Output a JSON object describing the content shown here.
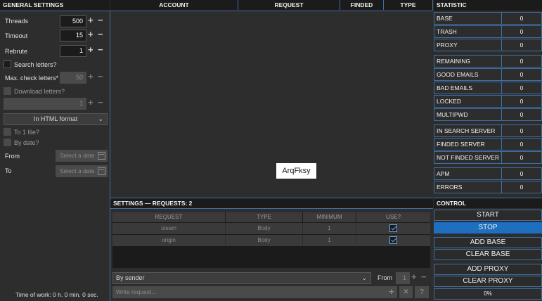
{
  "general": {
    "title": "GENERAL SETTINGS",
    "threads": {
      "label": "Threads",
      "value": "500"
    },
    "timeout": {
      "label": "Timeout",
      "value": "15"
    },
    "rebrute": {
      "label": "Rebrute",
      "value": "1"
    },
    "search_letters": "Search letters?",
    "max_check": {
      "label": "Max. check letters*",
      "value": "50"
    },
    "download_letters": "Download letters?",
    "download_value": "1",
    "format_select": "In HTML format",
    "to_one_file": "To 1 file?",
    "by_date": "By date?",
    "from_label": "From",
    "to_label": "To",
    "date_placeholder": "Select a date",
    "time_of_work": "Time of work: 0 h. 0 min. 0 sec."
  },
  "results": {
    "columns": [
      "ACCOUNT",
      "REQUEST",
      "FINDED",
      "TYPE"
    ],
    "overlay_text": "ArqFksy"
  },
  "statistic": {
    "title": "STATISTIC",
    "groups": [
      [
        {
          "label": "BASE",
          "value": "0"
        },
        {
          "label": "TRASH",
          "value": "0"
        },
        {
          "label": "PROXY",
          "value": "0"
        }
      ],
      [
        {
          "label": "REMAINING",
          "value": "0"
        },
        {
          "label": "GOOD EMAILS",
          "value": "0"
        },
        {
          "label": "BAD EMAILS",
          "value": "0"
        },
        {
          "label": "LOCKED",
          "value": "0"
        },
        {
          "label": "MULTIPWD",
          "value": "0"
        }
      ],
      [
        {
          "label": "IN SEARCH SERVER",
          "value": "0"
        },
        {
          "label": "FINDED SERVER",
          "value": "0"
        },
        {
          "label": "NOT FINDED SERVER",
          "value": "0"
        }
      ],
      [
        {
          "label": "APM",
          "value": "0"
        },
        {
          "label": "ERRORS",
          "value": "0"
        }
      ]
    ]
  },
  "settings": {
    "title": "SETTINGS — REQUESTS: 2",
    "columns": [
      "REQUEST",
      "TYPE",
      "MINIMUM",
      "USE?"
    ],
    "rows": [
      {
        "request": "steam",
        "type": "Body",
        "minimum": "1",
        "use": true
      },
      {
        "request": "origin",
        "type": "Body",
        "minimum": "1",
        "use": true
      }
    ],
    "sender_select": "By sender",
    "from_label": "From",
    "from_value": "1",
    "write_placeholder": "Write request..."
  },
  "control": {
    "title": "CONTROL",
    "start": "START",
    "stop": "STOP",
    "add_base": "ADD BASE",
    "clear_base": "CLEAR BASE",
    "add_proxy": "ADD PROXY",
    "clear_proxy": "CLEAR PROXY",
    "progress": "0%"
  }
}
